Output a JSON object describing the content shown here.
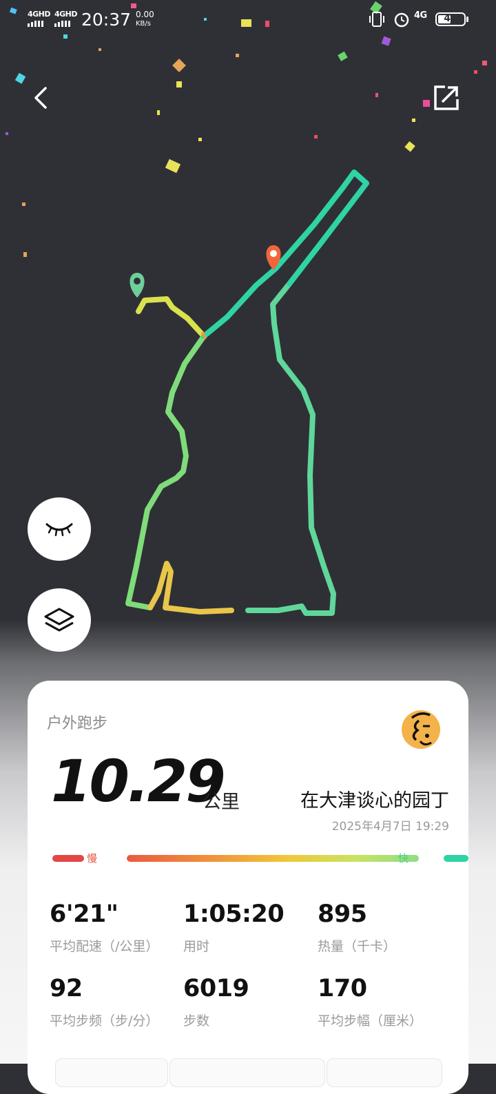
{
  "status_bar": {
    "network1": "4GHD",
    "network2": "4GHD",
    "time": "20:37",
    "speed_value": "0.00",
    "speed_unit": "KB/s",
    "mobile": "4G",
    "battery": "45",
    "battery_level": 0.45
  },
  "workout": {
    "type": "户外跑步",
    "distance": "10.29",
    "unit": "公里",
    "user_name": "在大津谈心的园丁",
    "datetime": "2025年4月7日 19:29"
  },
  "pace_legend": {
    "slow": "慢",
    "fast": "快"
  },
  "stats": [
    {
      "value": "6'21\"",
      "label": "平均配速（/公里）"
    },
    {
      "value": "1:05:20",
      "label": "用时"
    },
    {
      "value": "895",
      "label": "热量（千卡）"
    },
    {
      "value": "92",
      "label": "平均步频（步/分）"
    },
    {
      "value": "6019",
      "label": "步数"
    },
    {
      "value": "170",
      "label": "平均步幅（厘米）"
    }
  ],
  "icons": {
    "back": "chevron-left-icon",
    "share": "share-icon",
    "hide": "closed-eye-icon",
    "layers": "layers-icon",
    "start": "start-pin-icon",
    "end": "end-pin-icon"
  },
  "colors": {
    "slow": "#e24746",
    "fast": "#2fd3a6",
    "route_green": "#7fdc7a",
    "route_teal": "#2fd3a6",
    "route_yellow": "#e8d64a",
    "start_pin": "#6fcf9a",
    "end_pin": "#f0663a",
    "map_bg": "#2f3036"
  }
}
